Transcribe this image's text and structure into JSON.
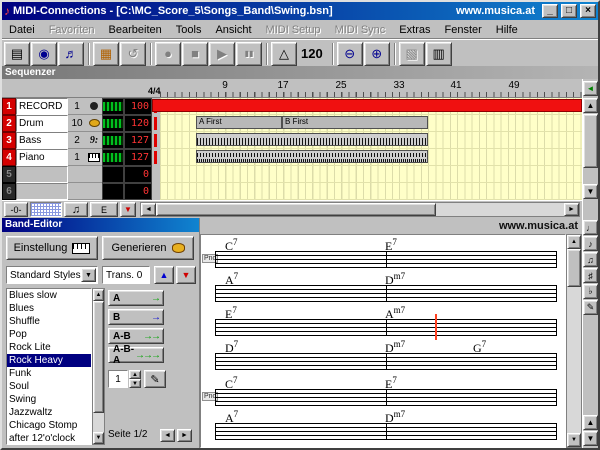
{
  "brand": {
    "site": "www.musica.at"
  },
  "colors": {
    "titlebar": "#000080",
    "titlebar_light": "#1084d0",
    "record_red": "#f01010",
    "lane_bg": "#ffffc8",
    "selection": "#000080",
    "led_red": "#ff3434"
  },
  "window": {
    "title": "MIDI-Connections - [C:\\MC_Score_5\\Songs_Band\\Swing.bsn]",
    "controls": {
      "minimize": "_",
      "maximize": "□",
      "close": "×"
    }
  },
  "icons": {
    "app": "♪",
    "dropdown": "▼",
    "up": "▲",
    "down": "▼",
    "left": "◄",
    "right": "►",
    "marker": "▼",
    "scroll_left": "◄",
    "pencil": "✎",
    "bass_clef": "9:",
    "tools": [
      "♩",
      "♪",
      "♫",
      "♯",
      "♭",
      "✎"
    ]
  },
  "menu": {
    "items": [
      {
        "label": "Datei"
      },
      {
        "label": "Favoriten"
      },
      {
        "label": "Bearbeiten"
      },
      {
        "label": "Tools"
      },
      {
        "label": "Ansicht"
      },
      {
        "label": "MIDI Setup"
      },
      {
        "label": "MIDI Sync"
      },
      {
        "label": "Extras"
      },
      {
        "label": "Fenster"
      },
      {
        "label": "Hilfe"
      }
    ]
  },
  "toolbar": {
    "tempo": "120",
    "buttons": [
      {
        "name": "open",
        "glyph": "▤"
      },
      {
        "name": "cd",
        "glyph": "◉"
      },
      {
        "name": "notes",
        "glyph": "♬"
      },
      {
        "name": "print",
        "glyph": "▦"
      },
      {
        "name": "undo",
        "glyph": "↺"
      },
      {
        "name": "record",
        "glyph": "●"
      },
      {
        "name": "stop",
        "glyph": "■"
      },
      {
        "name": "play",
        "glyph": "▶"
      },
      {
        "name": "pause",
        "glyph": "▮▮"
      },
      {
        "name": "metronome",
        "glyph": "△"
      },
      {
        "name": "zoom-out",
        "glyph": "⊖"
      },
      {
        "name": "zoom-in",
        "glyph": "⊕"
      },
      {
        "name": "midi",
        "glyph": "▧"
      },
      {
        "name": "keyboard",
        "glyph": "▥"
      }
    ]
  },
  "sequencer": {
    "header": "Sequenzer",
    "time_signature": "4/4",
    "ruler_numbers": [
      "9",
      "17",
      "25",
      "33",
      "41",
      "49"
    ],
    "tracks": [
      {
        "num": "1",
        "name": "RECORD",
        "channel": "1",
        "volume": "100"
      },
      {
        "num": "2",
        "name": "Drum",
        "channel": "10",
        "volume": "120"
      },
      {
        "num": "3",
        "name": "Bass",
        "channel": "2",
        "volume": "127"
      },
      {
        "num": "4",
        "name": "Piano",
        "channel": "1",
        "volume": "127"
      },
      {
        "num": "5",
        "name": "",
        "channel": "",
        "volume": "0"
      },
      {
        "num": "6",
        "name": "",
        "channel": "",
        "volume": "0"
      }
    ],
    "clips": {
      "drum_a": "A First",
      "drum_b": "B First"
    },
    "bottom": {
      "zero_tab": "-0-",
      "edit_tab": "E"
    }
  },
  "band_editor": {
    "title": "Band-Editor",
    "settings_button": "Einstellung",
    "generate_button": "Generieren",
    "style_category": "Standard Styles",
    "transpose": "Trans. 0",
    "styles": [
      "Blues slow",
      "Blues",
      "Shuffle",
      "Pop",
      "Rock Lite",
      "Rock Heavy",
      "Funk",
      "Soul",
      "Swing",
      "Jazzwaltz",
      "Chicago Stomp",
      "after 12'o'clock"
    ],
    "selected_style": "Rock Heavy",
    "patterns": [
      {
        "label": "A",
        "arrows": "→"
      },
      {
        "label": "B",
        "arrows": "→"
      },
      {
        "label": "A-B",
        "arrows": "→→"
      },
      {
        "label": "A-B-A",
        "arrows": "→→→"
      }
    ],
    "repeat_count": "1",
    "page_label": "Seite 1/2"
  },
  "score": {
    "systems": [
      {
        "label": "Pno",
        "chords": [
          {
            "root": "C",
            "ext": "7"
          },
          {
            "root": "E",
            "ext": "7"
          }
        ]
      },
      {
        "chords": [
          {
            "root": "A",
            "ext": "7"
          },
          {
            "root": "D",
            "ext": "m7"
          }
        ]
      },
      {
        "chords": [
          {
            "root": "E",
            "ext": "7"
          },
          {
            "root": "A",
            "ext": "m7"
          }
        ]
      },
      {
        "chords": [
          {
            "root": "D",
            "ext": "7"
          },
          {
            "root": "D",
            "ext": "m7"
          },
          {
            "root": "G",
            "ext": "7"
          }
        ]
      },
      {
        "label": "Pno",
        "chords": [
          {
            "root": "C",
            "ext": "7"
          },
          {
            "root": "E",
            "ext": "7"
          }
        ]
      },
      {
        "chords": [
          {
            "root": "A",
            "ext": "7"
          },
          {
            "root": "D",
            "ext": "m7"
          }
        ]
      }
    ]
  }
}
